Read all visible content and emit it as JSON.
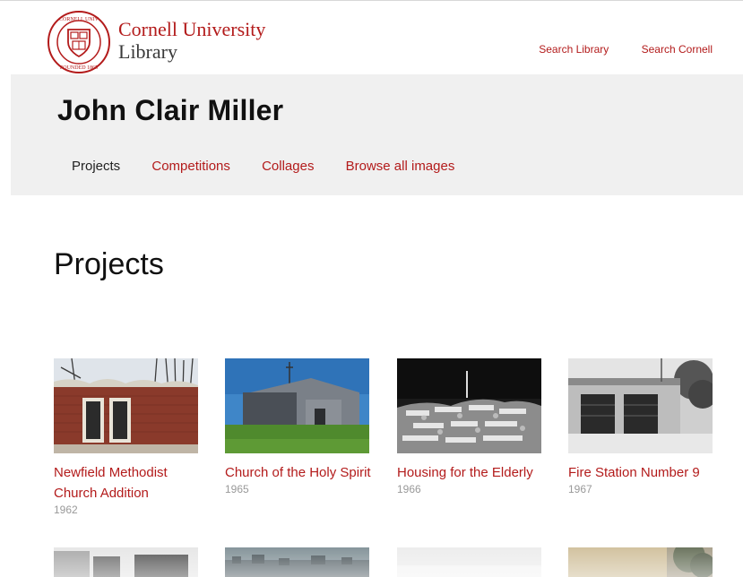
{
  "header": {
    "logo_line1": "Cornell University",
    "logo_line2": "Library",
    "links": [
      "Search Library",
      "Search Cornell"
    ]
  },
  "site": {
    "title": "John Clair Miller",
    "nav": [
      {
        "label": "Projects",
        "active": true
      },
      {
        "label": "Competitions",
        "active": false
      },
      {
        "label": "Collages",
        "active": false
      },
      {
        "label": "Browse all images",
        "active": false
      }
    ]
  },
  "main": {
    "section_title": "Projects",
    "cards": [
      {
        "title": "Newfield Methodist Church Addition",
        "year": "1962"
      },
      {
        "title": "Church of the Holy Spirit",
        "year": "1965"
      },
      {
        "title": "Housing for the Elderly",
        "year": "1966"
      },
      {
        "title": "Fire Station Number 9",
        "year": "1967"
      }
    ]
  },
  "colors": {
    "accent": "#b31b1b",
    "band": "#f0f0f0"
  }
}
